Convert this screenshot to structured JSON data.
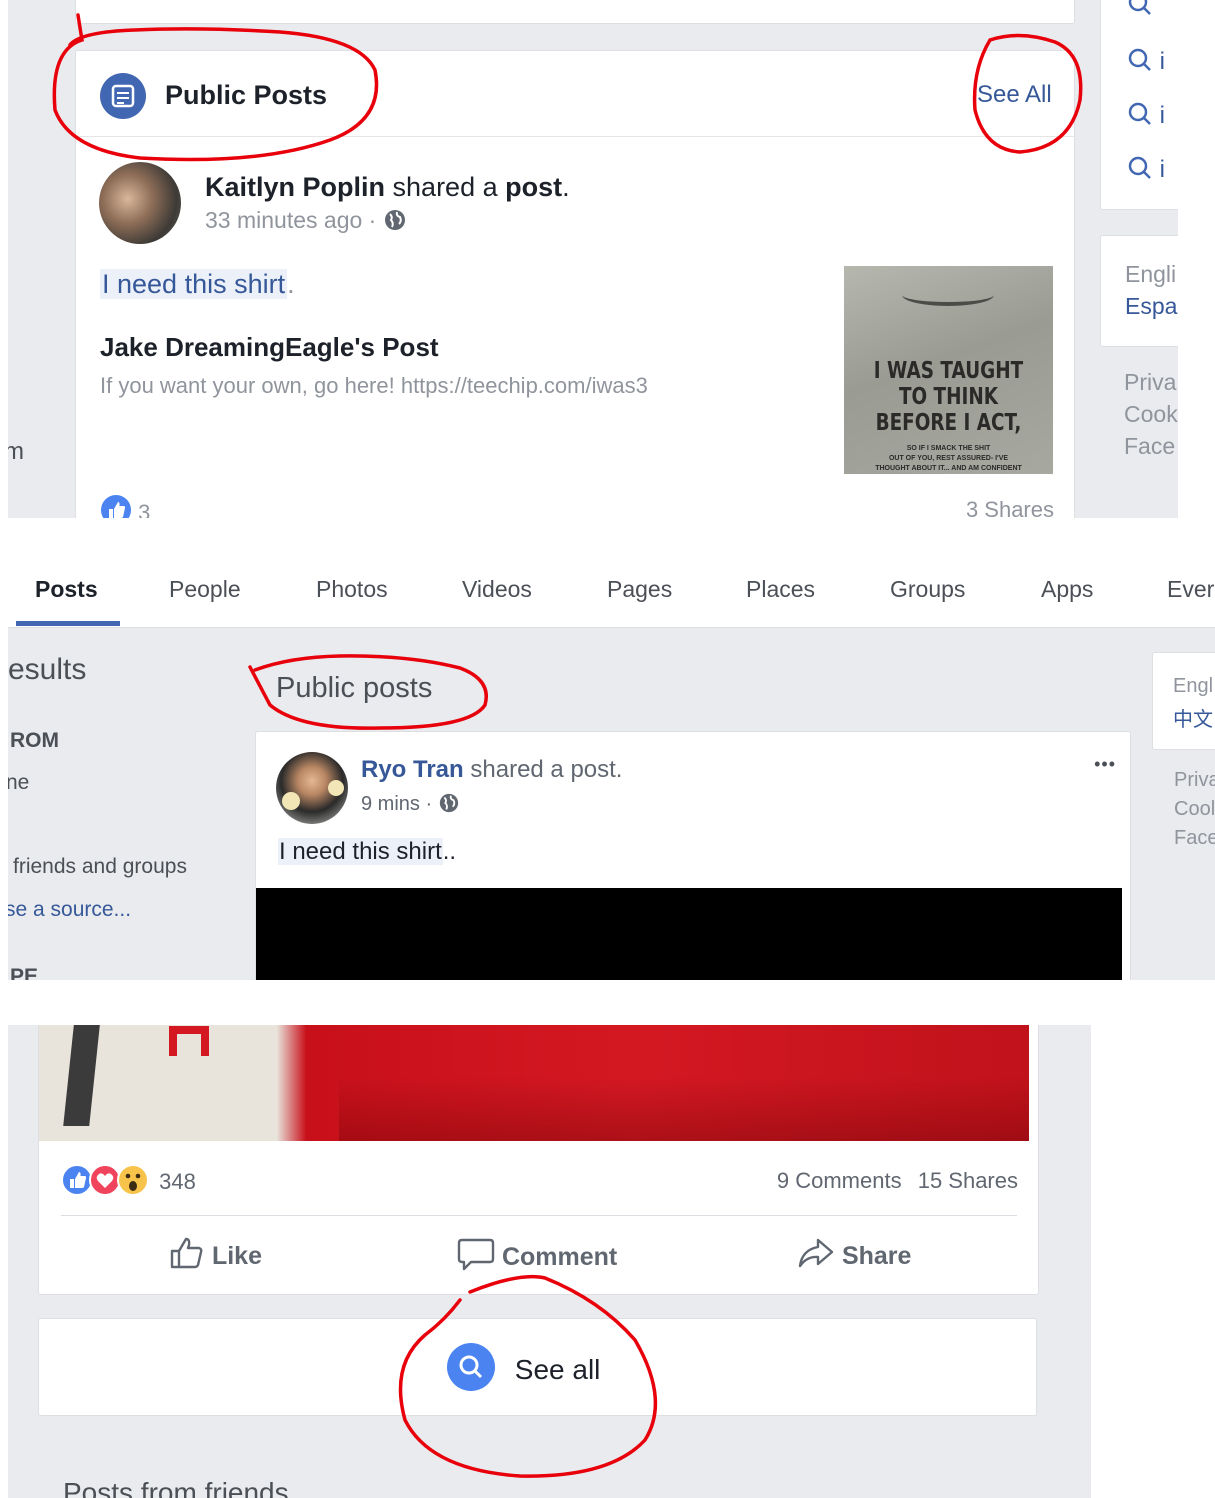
{
  "panel1": {
    "section_title": "Public Posts",
    "see_all": "See All",
    "post": {
      "author": "Kaitlyn Poplin",
      "action_pre": "shared a",
      "action_obj": "post",
      "action_end": ".",
      "time": "33 minutes ago",
      "dot": "·",
      "text": "I need this shirt",
      "text_end": ".",
      "shared_title": "Jake DreamingEagle's Post",
      "shared_desc": "If you want your own, go here! https://teechip.com/iwas3",
      "image_lines": [
        "I WAS TAUGHT",
        "TO THINK",
        "BEFORE I ACT,"
      ],
      "image_small": [
        "SO IF I SMACK THE SHIT",
        "OUT OF YOU, REST ASSURED- I'VE",
        "THOUGHT ABOUT IT... AND AM CONFIDENT"
      ],
      "like_count": "3",
      "shares": "3 Shares"
    },
    "right_rail": {
      "search_items": [
        "i",
        "i",
        "i"
      ],
      "languages": [
        "Engli",
        "Espa"
      ],
      "footer": [
        "Priva",
        "Cook",
        "Face"
      ]
    },
    "left_fragment": "m"
  },
  "panel2": {
    "tabs": [
      "Posts",
      "People",
      "Photos",
      "Videos",
      "Pages",
      "Places",
      "Groups",
      "Apps",
      "Ever"
    ],
    "active_tab": "Posts",
    "sidebar": {
      "results": "esults",
      "from": "ROM",
      "one": "ne",
      "friends_groups": "friends and groups",
      "source": "se a source...",
      "date": "PE"
    },
    "section_title": "Public posts",
    "post": {
      "author": "Ryo Tran",
      "action": "shared a post.",
      "time": "9 mins",
      "dot": "·",
      "text": "I need this shirt",
      "text_end": "..",
      "more": "•••"
    },
    "right_rail": {
      "languages": [
        "Engl",
        "中文"
      ],
      "footer": [
        "Priva",
        "Cool",
        "Face"
      ]
    }
  },
  "panel3": {
    "reaction_count": "348",
    "comments": "9 Comments",
    "shares": "15 Shares",
    "actions": {
      "like": "Like",
      "comment": "Comment",
      "share": "Share"
    },
    "see_all": "See all",
    "next_section": "Posts from friends"
  },
  "colors": {
    "fb_blue": "#365899",
    "accent_blue": "#4267b2",
    "annotation_red": "#e8000b",
    "background": "#e9ebee"
  }
}
